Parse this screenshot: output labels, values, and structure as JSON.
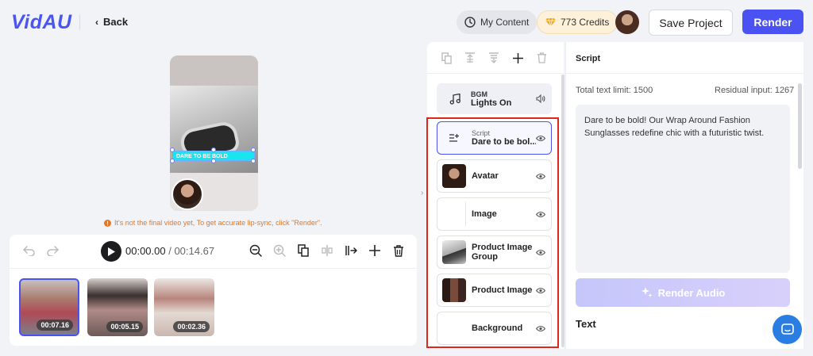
{
  "header": {
    "logo": "VidAU",
    "back_label": "Back",
    "my_content_label": "My Content",
    "credits_label": "773 Credits",
    "save_label": "Save Project",
    "render_label": "Render"
  },
  "preview": {
    "caption": "DARE TO BE BOLD",
    "warning": "It's not the final video yet, To get accurate lip-sync, click \"Render\"."
  },
  "player": {
    "current_time": "00:00.00",
    "separator": " / ",
    "total_time": "00:14.67"
  },
  "clips": [
    {
      "duration": "00:07.16",
      "selected": true
    },
    {
      "duration": "00:05.15",
      "selected": false
    },
    {
      "duration": "00:02.36",
      "selected": false
    }
  ],
  "layers": {
    "bgm": {
      "type": "BGM",
      "name": "Lights On"
    },
    "script": {
      "type": "Script",
      "name": "Dare to be bol..."
    },
    "items": [
      {
        "label": "Avatar"
      },
      {
        "label": "Image"
      },
      {
        "label": "Product Image Group"
      },
      {
        "label": "Product Image"
      },
      {
        "label": "Background"
      }
    ]
  },
  "script_panel": {
    "title": "Script",
    "limit_label": "Total text limit: 1500",
    "residual_label": "Residual input: 1267",
    "text": "Dare to be bold! Our Wrap Around Fashion Sunglasses redefine chic with a futuristic twist.",
    "render_audio_label": "Render Audio",
    "text_section_label": "Text"
  },
  "colors": {
    "brand": "#4a52f2",
    "warning": "#e0772a",
    "highlight_box": "#e0261e"
  }
}
